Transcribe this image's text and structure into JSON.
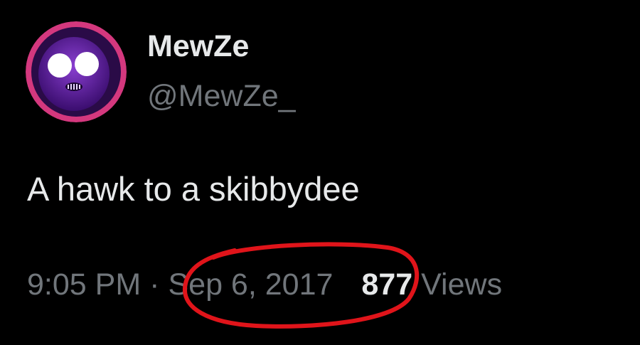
{
  "user": {
    "display_name": "MewZe",
    "handle": "@MewZe_",
    "avatar_icon": "purple-ghost-avatar",
    "avatar_ring_color": "#d4387e"
  },
  "tweet": {
    "text": "A hawk to a skibbydee",
    "time": "9:05 PM",
    "separator": "·",
    "date": "Sep 6, 2017",
    "views_count": "877",
    "views_label": "Views"
  },
  "annotation": {
    "type": "hand-drawn-circle",
    "target": "date",
    "color": "#e0141a"
  },
  "colors": {
    "background": "#000000",
    "primary_text": "#e7e9ea",
    "secondary_text": "#71767b"
  }
}
